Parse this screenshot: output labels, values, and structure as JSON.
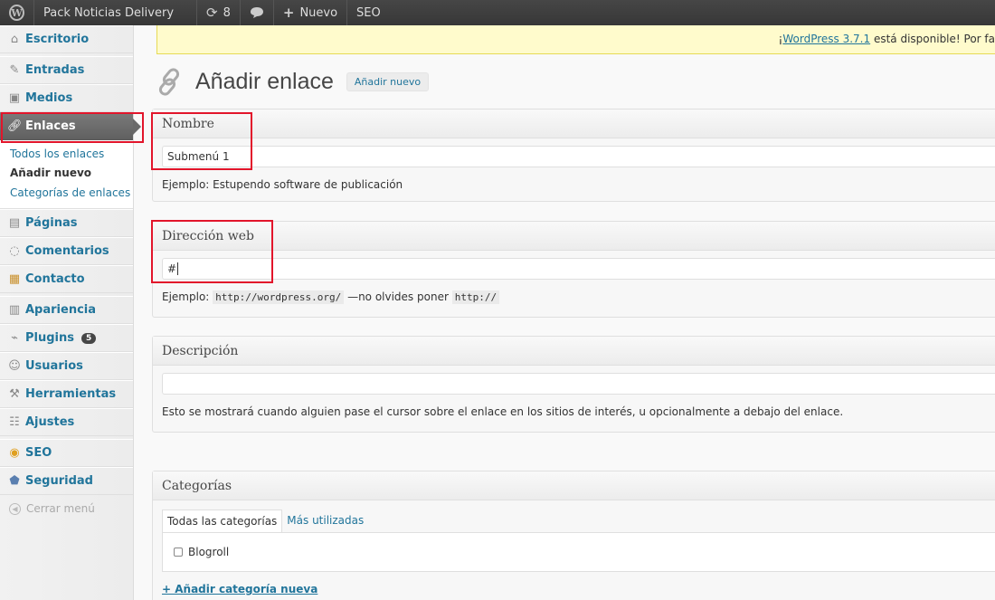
{
  "adminbar": {
    "site_name": "Pack Noticias Delivery",
    "updates_count": "8",
    "new_label": "Nuevo",
    "seo_label": "SEO"
  },
  "sidebar": {
    "items": {
      "escritorio": "Escritorio",
      "entradas": "Entradas",
      "medios": "Medios",
      "enlaces": "Enlaces",
      "paginas": "Páginas",
      "comentarios": "Comentarios",
      "contacto": "Contacto",
      "apariencia": "Apariencia",
      "plugins": "Plugins",
      "usuarios": "Usuarios",
      "herramientas": "Herramientas",
      "ajustes": "Ajustes",
      "seo": "SEO",
      "seguridad": "Seguridad"
    },
    "plugins_badge": "5",
    "submenu": {
      "all": "Todos los enlaces",
      "add": "Añadir nuevo",
      "categories": "Categorías de enlaces"
    },
    "collapse": "Cerrar menú"
  },
  "notice": {
    "prefix": "¡",
    "link": "WordPress 3.7.1",
    "text": " está disponible! Por fa"
  },
  "page": {
    "title": "Añadir enlace",
    "add_new": "Añadir nuevo"
  },
  "name_box": {
    "title": "Nombre",
    "value": "Submenú 1",
    "hint": "Ejemplo: Estupendo software de publicación"
  },
  "url_box": {
    "title": "Dirección web",
    "value": "#",
    "hint_prefix": "Ejemplo:",
    "hint_code1": "http://wordpress.org/",
    "hint_mid": "—no olvides poner",
    "hint_code2": "http://"
  },
  "desc_box": {
    "title": "Descripción",
    "value": "",
    "hint": "Esto se mostrará cuando alguien pase el cursor sobre el enlace en los sitios de interés, u opcionalmente a debajo del enlace."
  },
  "cat_box": {
    "title": "Categorías",
    "tab_all": "Todas las categorías",
    "tab_popular": "Más utilizadas",
    "category": "Blogroll",
    "add_category": "+ Añadir categoría nueva"
  },
  "colors": {
    "link": "#21759b",
    "highlight": "#e2152b",
    "admin_bar": "#464646"
  }
}
